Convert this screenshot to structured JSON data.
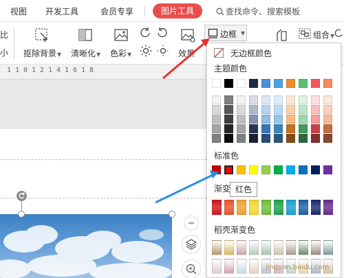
{
  "tabs": {
    "view": "视图",
    "dev_tools": "开发工具",
    "member": "会员专享",
    "picture_tools": "图片工具",
    "search_placeholder": "查找命令、搜索模板"
  },
  "ribbon": {
    "crop_label_top": "比",
    "crop_label_bottom": "小",
    "remove_bg": "抠除背景",
    "sharpen": "清晰化",
    "color": "色彩",
    "effects": "效果",
    "border": "边框",
    "group": "组合"
  },
  "ruler": {
    "ticks": [
      "1",
      "1",
      "0",
      "1",
      "2",
      "1",
      "4",
      "1",
      "6",
      "1",
      "8"
    ]
  },
  "border_menu": {
    "no_border": "无边框颜色",
    "theme_colors_title": "主题颜色",
    "standard_colors_title": "标准色",
    "gradient_title": "渐变",
    "bright_gradient_title": "稻壳渐变色",
    "tooltip": "红色",
    "selected_color": "#ff0000",
    "theme_top_row": [
      "#ffffff",
      "#000000",
      "#ffffff",
      "#1f2a44",
      "#4a90d9",
      "#4aa3df",
      "#f08c2e",
      "#5bbd72",
      "#f05a5a",
      "#f28a5a"
    ],
    "theme_shades": [
      [
        "#f2f2f2",
        "#7f7f7f",
        "#f2f2f2",
        "#d6dbe5",
        "#dbe8f7",
        "#dbedf9",
        "#fde8d5",
        "#def2e3",
        "#fddede",
        "#fde8de"
      ],
      [
        "#d9d9d9",
        "#595959",
        "#d9d9d9",
        "#adb7cb",
        "#b7d2ef",
        "#b7dbf2",
        "#fbd1ab",
        "#bde5c7",
        "#fbbdbd",
        "#fbd1bd"
      ],
      [
        "#bfbfbf",
        "#3f3f3f",
        "#bfbfbf",
        "#8393b1",
        "#93bce7",
        "#93c8ec",
        "#f9ba81",
        "#9cd8ab",
        "#f99c9c",
        "#f9ba9c"
      ],
      [
        "#a5a5a5",
        "#262626",
        "#a5a5a5",
        "#2a3650",
        "#3a73b5",
        "#3a86b8",
        "#c46f22",
        "#439a5a",
        "#c44444",
        "#c46f44"
      ],
      [
        "#7f7f7f",
        "#0d0d0d",
        "#7f7f7f",
        "#1a2133",
        "#274d79",
        "#27597b",
        "#834a16",
        "#2d673c",
        "#832d2d",
        "#834a2d"
      ]
    ],
    "standard_colors": [
      "#c00000",
      "#ff0000",
      "#ffc000",
      "#ffff00",
      "#92d050",
      "#00b050",
      "#00b0f0",
      "#0070c0",
      "#002060",
      "#7030a0"
    ],
    "gradients": [
      "#d0161b",
      "#e8532a",
      "#f0a030",
      "#f2d82a",
      "#6cbf3a",
      "#1fa34a",
      "#1aa0d0",
      "#1f5fa8",
      "#1d2a6e",
      "#6b2b8e"
    ],
    "bright_gradients": [
      [
        "#b89a6a",
        "#d8b860",
        "#c9a3a3",
        "#b8c8c0",
        "#a8c0b0",
        "#cfc4a8",
        "#a89a8a",
        "#6a8a6a",
        "#9a8a7a",
        "#7a9a9a"
      ],
      [
        "#e0c8d0",
        "#d0a0b0",
        "#c8d8e0",
        "#e8d0b8",
        "#b8c0d8",
        "#d8b8c8",
        "#c0d8c8",
        "#e0d8b0",
        "#a8b8c8",
        "#d8c0a8"
      ]
    ]
  },
  "watermark": "jingyan.baidu.com"
}
